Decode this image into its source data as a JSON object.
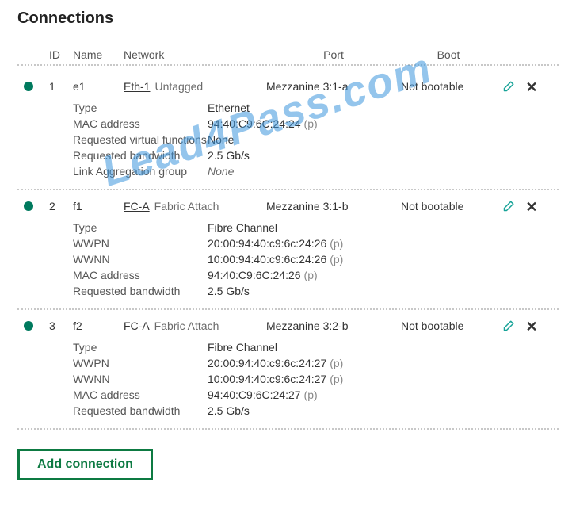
{
  "watermark": "Lead4Pass.com",
  "title": "Connections",
  "headers": {
    "id": "ID",
    "name": "Name",
    "network": "Network",
    "port": "Port",
    "boot": "Boot"
  },
  "add_button": "Add connection",
  "detail_labels": {
    "type": "Type",
    "mac": "MAC address",
    "rvf": "Requested virtual functions",
    "rbw": "Requested bandwidth",
    "lag": "Link Aggregation group",
    "wwpn": "WWPN",
    "wwnn": "WWNN"
  },
  "rows": [
    {
      "id": "1",
      "name": "e1",
      "network": "Eth-1",
      "net_type": "Untagged",
      "port": "Mezzanine 3:1-a",
      "boot": "Not bootable",
      "kind": "eth",
      "type": "Ethernet",
      "mac": "94:40:C9:6C:24:24",
      "mac_suffix": "(p)",
      "rvf": "None",
      "rbw": "2.5 Gb/s",
      "lag": "None"
    },
    {
      "id": "2",
      "name": "f1",
      "network": "FC-A",
      "net_type": "Fabric Attach",
      "port": "Mezzanine 3:1-b",
      "boot": "Not bootable",
      "kind": "fc",
      "type": "Fibre Channel",
      "wwpn": "20:00:94:40:c9:6c:24:26",
      "wwpn_suffix": "(p)",
      "wwnn": "10:00:94:40:c9:6c:24:26",
      "wwnn_suffix": "(p)",
      "mac": "94:40:C9:6C:24:26",
      "mac_suffix": "(p)",
      "rbw": "2.5 Gb/s"
    },
    {
      "id": "3",
      "name": "f2",
      "network": "FC-A",
      "net_type": "Fabric Attach",
      "port": "Mezzanine 3:2-b",
      "boot": "Not bootable",
      "kind": "fc",
      "type": "Fibre Channel",
      "wwpn": "20:00:94:40:c9:6c:24:27",
      "wwpn_suffix": "(p)",
      "wwnn": "10:00:94:40:c9:6c:24:27",
      "wwnn_suffix": "(p)",
      "mac": "94:40:C9:6C:24:27",
      "mac_suffix": "(p)",
      "rbw": "2.5 Gb/s"
    }
  ]
}
